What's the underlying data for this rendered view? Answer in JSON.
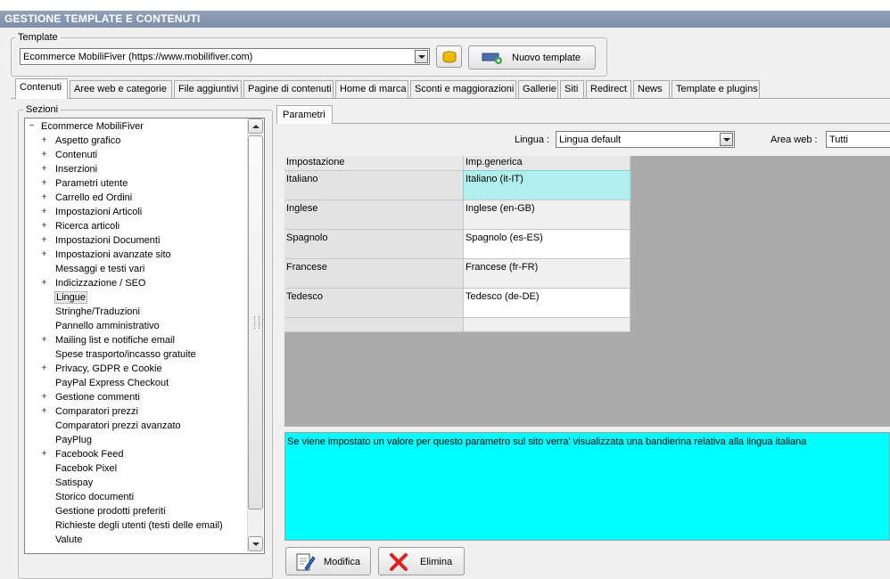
{
  "window": {
    "title": "GESTIONE TEMPLATE E CONTENUTI"
  },
  "template": {
    "group_label": "Template",
    "selected": "Ecommerce MobiliFiver (https://www.mobilifiver.com)",
    "new_button_label": "Nuovo template"
  },
  "tabs": [
    {
      "label": "Contenuti"
    },
    {
      "label": "Aree web e categorie"
    },
    {
      "label": "File aggiuntivi"
    },
    {
      "label": "Pagine di contenuti"
    },
    {
      "label": "Home di marca"
    },
    {
      "label": "Sconti e maggiorazioni"
    },
    {
      "label": "Gallerie"
    },
    {
      "label": "Siti"
    },
    {
      "label": "Redirect"
    },
    {
      "label": "News"
    },
    {
      "label": "Template e plugins"
    }
  ],
  "sections": {
    "group_label": "Sezioni",
    "root": "Ecommerce MobiliFiver",
    "items": [
      {
        "label": "Aspetto grafico",
        "expandable": true
      },
      {
        "label": "Contenuti",
        "expandable": true
      },
      {
        "label": "Inserzioni",
        "expandable": true
      },
      {
        "label": "Parametri utente",
        "expandable": true
      },
      {
        "label": "Carrello ed Ordini",
        "expandable": true
      },
      {
        "label": "Impostazioni Articoli",
        "expandable": true
      },
      {
        "label": "Ricerca articoli",
        "expandable": true
      },
      {
        "label": "Impostazioni Documenti",
        "expandable": true
      },
      {
        "label": "Impostazioni avanzate sito",
        "expandable": true
      },
      {
        "label": "Messaggi e testi vari",
        "expandable": false
      },
      {
        "label": "Indicizzazione / SEO",
        "expandable": true
      },
      {
        "label": "Lingue",
        "expandable": false,
        "selected": true
      },
      {
        "label": "Stringhe/Traduzioni",
        "expandable": false
      },
      {
        "label": "Pannello amministrativo",
        "expandable": false
      },
      {
        "label": "Mailing list e notifiche email",
        "expandable": true
      },
      {
        "label": "Spese trasporto/incasso gratuite",
        "expandable": false
      },
      {
        "label": "Privacy, GDPR e Cookie",
        "expandable": true
      },
      {
        "label": "PayPal Express Checkout",
        "expandable": false
      },
      {
        "label": "Gestione commenti",
        "expandable": true
      },
      {
        "label": "Comparatori prezzi",
        "expandable": true
      },
      {
        "label": "Comparatori prezzi avanzato",
        "expandable": false
      },
      {
        "label": "PayPlug",
        "expandable": false
      },
      {
        "label": "Facebook Feed",
        "expandable": true
      },
      {
        "label": "Facebok Pixel",
        "expandable": false
      },
      {
        "label": "Satispay",
        "expandable": false
      },
      {
        "label": "Storico documenti",
        "expandable": false
      },
      {
        "label": "Gestione prodotti preferiti",
        "expandable": false
      },
      {
        "label": "Richieste degli utenti (testi delle email)",
        "expandable": false
      },
      {
        "label": "Valute",
        "expandable": false
      }
    ]
  },
  "parametri": {
    "tab_label": "Parametri",
    "lingua_label": "Lingua :",
    "lingua_value": "Lingua default",
    "area_label": "Area web :",
    "area_value": "Tutti",
    "columns": [
      "Impostazione",
      "Imp.generica"
    ],
    "rows": [
      {
        "setting": "Italiano",
        "value": "Italiano (it-IT)",
        "selected": true
      },
      {
        "setting": "Inglese",
        "value": "Inglese (en-GB)"
      },
      {
        "setting": "Spagnolo",
        "value": "Spagnolo (es-ES)"
      },
      {
        "setting": "Francese",
        "value": "Francese (fr-FR)"
      },
      {
        "setting": "Tedesco",
        "value": "Tedesco (de-DE)"
      }
    ],
    "description": "Se viene impostato un valore per questo parametro sul sito verra' visualizzata una bandierina relativa alla lingua italiana"
  },
  "actions": {
    "modifica_label": "Modifica",
    "elimina_label": "Elimina"
  },
  "colors": {
    "selected_row": "#b1efef",
    "description_bg": "#00ffff",
    "grid_empty": "#ababab"
  }
}
